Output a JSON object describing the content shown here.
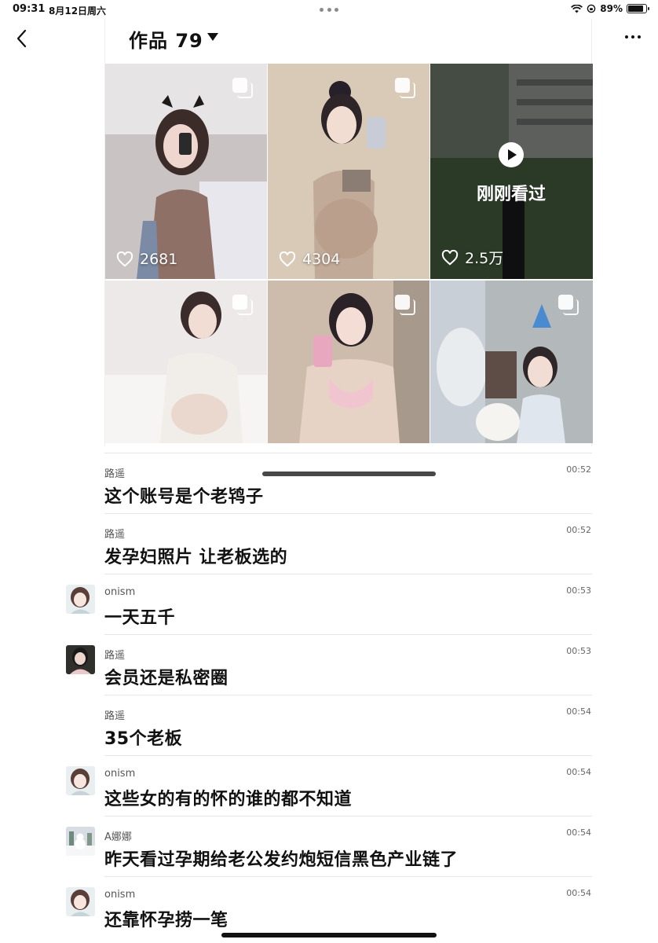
{
  "status_bar": {
    "time": "09:31",
    "date": "8月12日周六",
    "battery": "89%",
    "battery_level": 0.89
  },
  "header": {
    "title": "作品 79"
  },
  "works": [
    {
      "likes": "2681",
      "multi": true,
      "bg": "#b9a8a0"
    },
    {
      "likes": "4304",
      "multi": true,
      "bg": "#c7b5a2"
    },
    {
      "likes": "2.5万",
      "watched": true,
      "watched_label": "刚刚看过",
      "bg": "#5b6459"
    },
    {
      "multi": true,
      "bg": "#e4dfdc"
    },
    {
      "multi": true,
      "bg": "#b5a393"
    },
    {
      "multi": true,
      "bg": "#a8b1b3"
    }
  ],
  "messages": [
    {
      "sender": "路遥",
      "time": "00:52",
      "text": "这个账号是个老鸨子",
      "avatar": ""
    },
    {
      "sender": "路遥",
      "time": "00:52",
      "text": "发孕妇照片 让老板选的",
      "avatar": ""
    },
    {
      "sender": "onism",
      "time": "00:53",
      "text": "一天五千",
      "avatar": "girl-illustration"
    },
    {
      "sender": "路遥",
      "time": "00:53",
      "text": "会员还是私密圈",
      "avatar": "photo-dark"
    },
    {
      "sender": "路遥",
      "time": "00:54",
      "text": "35个老板",
      "avatar": ""
    },
    {
      "sender": "onism",
      "time": "00:54",
      "text": "这些女的有的怀的谁的都不知道",
      "avatar": "girl-illustration"
    },
    {
      "sender": "A娜娜",
      "time": "00:54",
      "text": "昨天看过孕期给老公发约炮短信黑色产业链了",
      "avatar": "snow-scene"
    },
    {
      "sender": "onism",
      "time": "00:54",
      "text": "还靠怀孕捞一笔",
      "avatar": "girl-illustration"
    }
  ]
}
